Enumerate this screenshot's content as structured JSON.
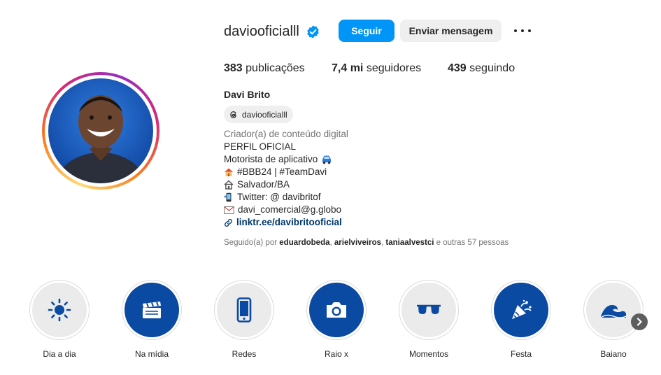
{
  "profile": {
    "username": "daviooficialll",
    "follow_label": "Seguir",
    "message_label": "Enviar mensagem",
    "stats": {
      "posts_count": "383",
      "posts_label": "publicações",
      "followers_count": "7,4 mi",
      "followers_label": "seguidores",
      "following_count": "439",
      "following_label": "seguindo"
    },
    "full_name": "Davi Brito",
    "threads_handle": "daviooficialll",
    "category": "Criador(a) de conteúdo digital",
    "bio": {
      "line1": "PERFIL OFICIAL",
      "line2": "Motorista de aplicativo",
      "line3": "#BBB24 | #TeamDavi",
      "line4": "Salvador/BA",
      "line5": "Twitter: @ davibritof",
      "line6": "davi_comercial@g.globo"
    },
    "link": "linktr.ee/davibritooficial",
    "followed_by": {
      "prefix": "Seguido(a) por",
      "user1": "eduardobeda",
      "user2": "arielviveiros",
      "user3": "taniaalvestci",
      "suffix": "e outras 57 pessoas"
    }
  },
  "highlights": [
    {
      "label": "Dia a dia",
      "icon": "sun-icon"
    },
    {
      "label": "Na mídia",
      "icon": "clapperboard-icon"
    },
    {
      "label": "Redes",
      "icon": "smartphone-icon"
    },
    {
      "label": "Raio x",
      "icon": "camera-icon"
    },
    {
      "label": "Momentos",
      "icon": "sunglasses-icon"
    },
    {
      "label": "Festa",
      "icon": "party-popper-icon"
    },
    {
      "label": "Baiano",
      "icon": "wave-icon"
    }
  ],
  "colors": {
    "accent": "#0095f6",
    "highlight_blue": "#0b4aa2",
    "link": "#00376b"
  }
}
